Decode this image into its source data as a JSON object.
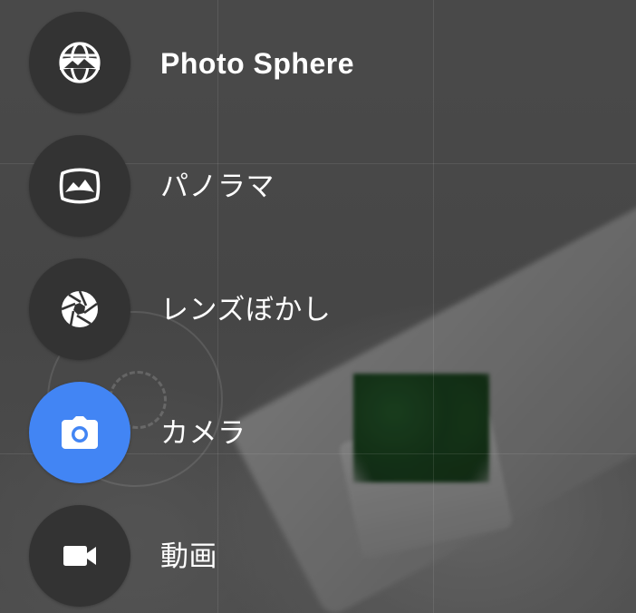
{
  "colors": {
    "icon_circle": "#333333",
    "icon_circle_active": "#4285f4",
    "label_text": "#ffffff"
  },
  "modes": [
    {
      "label": "Photo Sphere",
      "icon": "photo-sphere-icon",
      "active": false
    },
    {
      "label": "パノラマ",
      "icon": "panorama-icon",
      "active": false
    },
    {
      "label": "レンズぼかし",
      "icon": "lens-blur-aperture-icon",
      "active": false
    },
    {
      "label": "カメラ",
      "icon": "camera-icon",
      "active": true
    },
    {
      "label": "動画",
      "icon": "video-camera-icon",
      "active": false
    }
  ]
}
